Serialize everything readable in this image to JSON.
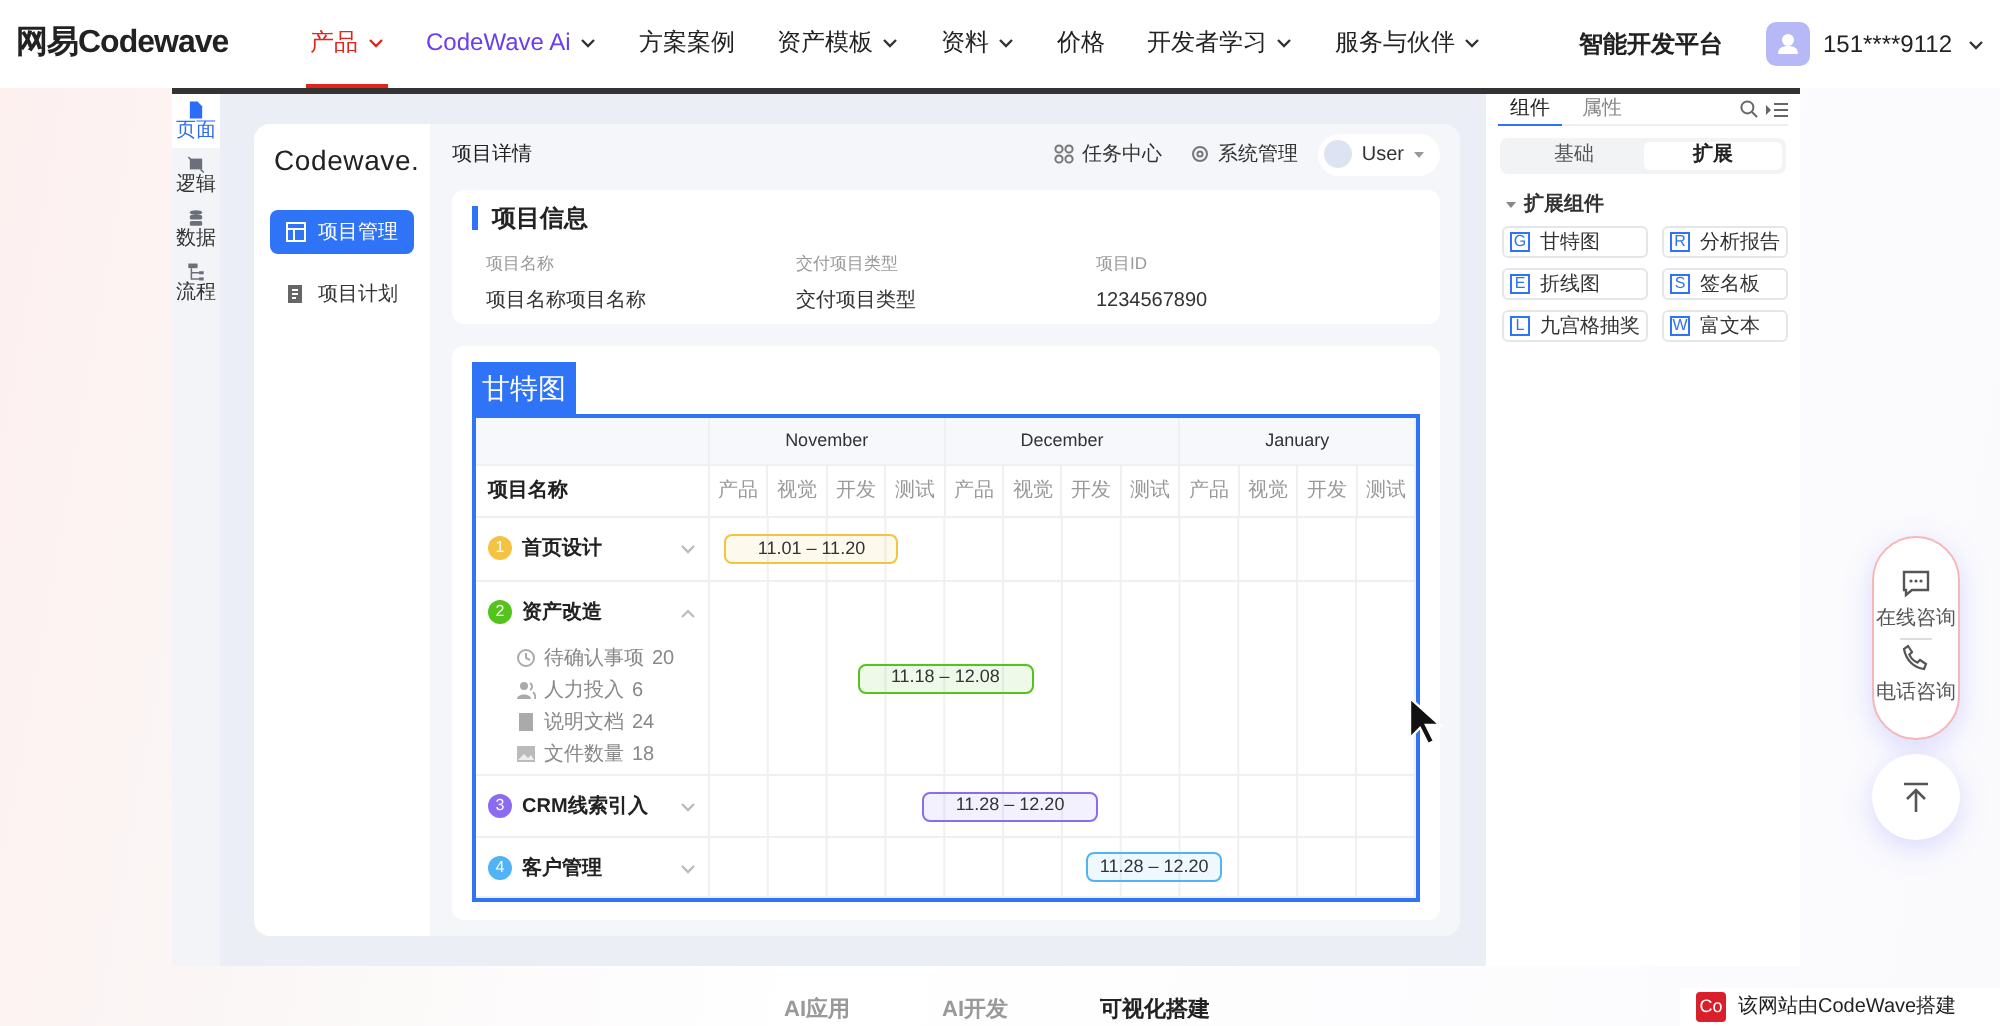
{
  "navbar": {
    "logo": "网易Codewave",
    "items": [
      {
        "label": "产品",
        "selected": true,
        "has_menu": true,
        "kind": "plain"
      },
      {
        "label": "CodeWave Ai",
        "selected": false,
        "has_menu": true,
        "kind": "ai"
      },
      {
        "label": "方案案例",
        "selected": false,
        "has_menu": false,
        "kind": "plain"
      },
      {
        "label": "资产模板",
        "selected": false,
        "has_menu": true,
        "kind": "plain"
      },
      {
        "label": "资料",
        "selected": false,
        "has_menu": true,
        "kind": "plain"
      },
      {
        "label": "价格",
        "selected": false,
        "has_menu": false,
        "kind": "plain"
      },
      {
        "label": "开发者学习",
        "selected": false,
        "has_menu": true,
        "kind": "plain"
      },
      {
        "label": "服务与伙伴",
        "selected": false,
        "has_menu": true,
        "kind": "plain"
      }
    ],
    "platform_link": "智能开发平台",
    "account": "151****9112"
  },
  "rail": [
    {
      "kind": "page",
      "label": "页面",
      "selected": true
    },
    {
      "kind": "logic",
      "label": "逻辑",
      "selected": false
    },
    {
      "kind": "data",
      "label": "数据",
      "selected": false
    },
    {
      "kind": "flow",
      "label": "流程",
      "selected": false
    }
  ],
  "app": {
    "logo": "Codewave.",
    "menu": [
      {
        "kind": "grid",
        "label": "项目管理",
        "selected": true
      },
      {
        "kind": "plan",
        "label": "项目计划",
        "selected": false
      }
    ],
    "page_title": "项目详情",
    "header_actions": [
      {
        "kind": "apps",
        "label": "任务中心"
      },
      {
        "kind": "gear",
        "label": "系统管理"
      }
    ],
    "user": "User",
    "info": {
      "title": "项目信息",
      "fields": [
        {
          "label": "项目名称",
          "value": "项目名称项目名称"
        },
        {
          "label": "交付项目类型",
          "value": "交付项目类型"
        },
        {
          "label": "项目ID",
          "value": "1234567890"
        }
      ]
    },
    "gantt": {
      "tag": "甘特图",
      "name_header": "项目名称",
      "months": [
        {
          "label": "November",
          "phases": [
            "产品",
            "视觉",
            "开发",
            "测试"
          ]
        },
        {
          "label": "December",
          "phases": [
            "产品",
            "视觉",
            "开发",
            "测试"
          ]
        },
        {
          "label": "January",
          "phases": [
            "产品",
            "视觉",
            "开发",
            "测试"
          ]
        }
      ],
      "rows": [
        {
          "number": "1",
          "name": "首页设计",
          "color": "#f5c342",
          "expanded": false,
          "range": "11.01 – 11.20"
        },
        {
          "number": "2",
          "name": "资产改造",
          "color": "#52c41a",
          "expanded": true,
          "range": "11.18 – 12.08",
          "details": [
            {
              "kind": "clock",
              "label": "待确认事项",
              "count": "20"
            },
            {
              "kind": "people",
              "label": "人力投入",
              "count": "6"
            },
            {
              "kind": "doc",
              "label": "说明文档",
              "count": "24"
            },
            {
              "kind": "image",
              "label": "文件数量",
              "count": "18"
            }
          ]
        },
        {
          "number": "3",
          "name": "CRM线索引入",
          "color": "#8b6cf0",
          "expanded": false,
          "range": "11.28 – 12.20"
        },
        {
          "number": "4",
          "name": "客户管理",
          "color": "#4fb3f6",
          "expanded": false,
          "range": "11.28 – 12.20"
        }
      ]
    }
  },
  "panel": {
    "tabs": [
      {
        "label": "组件",
        "selected": true
      },
      {
        "label": "属性",
        "selected": false
      }
    ],
    "segments": [
      {
        "label": "基础",
        "selected": false
      },
      {
        "label": "扩展",
        "selected": true
      }
    ],
    "section": {
      "title": "扩展组件",
      "expanded": true,
      "items": [
        {
          "letter": "G",
          "label": "甘特图"
        },
        {
          "letter": "R",
          "label": "分析报告"
        },
        {
          "letter": "E",
          "label": "折线图"
        },
        {
          "letter": "S",
          "label": "签名板"
        },
        {
          "letter": "L",
          "label": "九宫格抽奖"
        },
        {
          "letter": "W",
          "label": "富文本"
        }
      ]
    }
  },
  "float_buttons": [
    {
      "kind": "chat",
      "label": "在线咨询"
    },
    {
      "kind": "phone",
      "label": "电话咨询"
    }
  ],
  "footer_tabs": [
    {
      "label": "AI应用",
      "selected": false
    },
    {
      "label": "AI开发",
      "selected": false
    },
    {
      "label": "可视化搭建",
      "selected": true
    }
  ],
  "site_badge": {
    "logo": "Co",
    "text": "该网站由CodeWave搭建"
  }
}
